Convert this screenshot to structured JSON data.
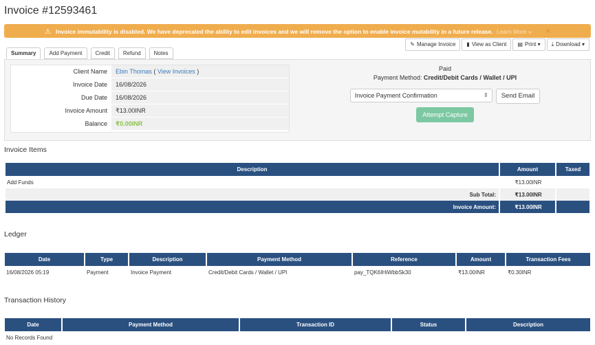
{
  "page": {
    "title": "Invoice #12593461"
  },
  "alert": {
    "message": "Invoice immutability is disabled. We have deprecated the ability to edit invoices and we will remove the option to enable invoice mutability in a future release.",
    "link": "Learn More »",
    "close": "×"
  },
  "tabs": [
    "Summary",
    "Add Payment",
    "Credit",
    "Refund",
    "Notes"
  ],
  "actions": {
    "manage": "Manage Invoice",
    "view_client": "View as Client",
    "print": "Print ▾",
    "download": "Download ▾"
  },
  "summary": {
    "client_name_label": "Client Name",
    "client_name": "Ebin Thomas",
    "view_invoices": "View Invoices",
    "invoice_date_label": "Invoice Date",
    "invoice_date": "16/08/2026",
    "due_date_label": "Due Date",
    "due_date": "16/08/2026",
    "invoice_amount_label": "Invoice Amount",
    "invoice_amount": "₹13.00INR",
    "balance_label": "Balance",
    "balance": "₹0.00INR"
  },
  "payment": {
    "status": "Paid",
    "method_label": "Payment Method:",
    "method": "Credit/Debit Cards / Wallet / UPI",
    "email_template": "Invoice Payment Confirmation",
    "send_email": "Send Email",
    "attempt_capture": "Attempt Capture"
  },
  "items": {
    "title": "Invoice Items",
    "headers": [
      "Description",
      "Amount",
      "Taxed"
    ],
    "rows": [
      {
        "description": "Add Funds",
        "amount": "₹13.00INR",
        "taxed": ""
      }
    ],
    "subtotal_label": "Sub Total:",
    "subtotal": "₹13.00INR",
    "total_label": "Invoice Amount:",
    "total": "₹13.00INR"
  },
  "ledger": {
    "title": "Ledger",
    "headers": [
      "Date",
      "Type",
      "Description",
      "Payment Method",
      "Reference",
      "Amount",
      "Transaction Fees"
    ],
    "row": {
      "date": "16/08/2026 05:19",
      "type": "Payment",
      "description": "Invoice Payment",
      "method": "Credit/Debit Cards / Wallet / UPI",
      "reference": "pay_TQK6IHiWbbSk30",
      "amount": "₹13.00INR",
      "fees": "₹0.30INR"
    }
  },
  "history": {
    "title": "Transaction History",
    "headers": [
      "Date",
      "Payment Method",
      "Transaction ID",
      "Status",
      "Description"
    ],
    "empty": "No Records Found"
  },
  "colors": {
    "header_bg": "#2a5080",
    "alert_bg": "#f0ad4e",
    "capture_bg": "#7cc8a2",
    "balance": "#8bc34a"
  }
}
